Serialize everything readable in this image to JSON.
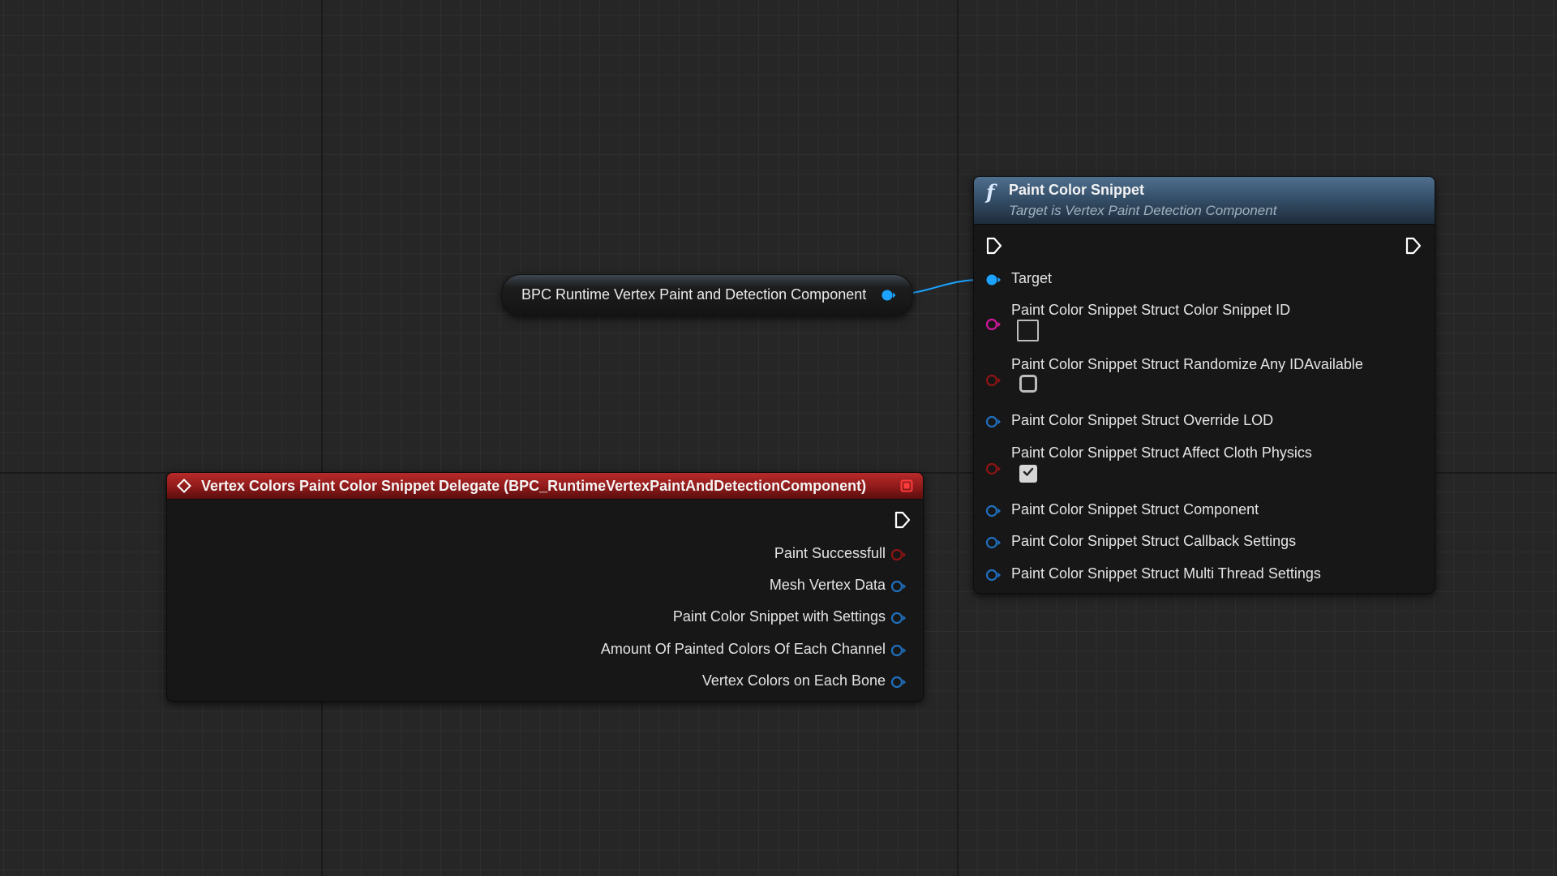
{
  "colors": {
    "background": "#262626",
    "object_pin": "#1ba3ff",
    "struct_pin": "#1f6fbf",
    "bool_pin": "#8e1414",
    "int_pin": "#d2189e",
    "function_header": "#36506a",
    "event_header": "#9a1e1e"
  },
  "variable_node": {
    "label": "BPC Runtime Vertex Paint and Detection Component",
    "pin_icon": "object-pin-icon"
  },
  "function_node": {
    "icon": "function-icon",
    "title": "Paint Color Snippet",
    "subtitle": "Target is Vertex Paint Detection Component",
    "inputs": [
      {
        "label": "Target",
        "pin": "object-pin-connected"
      },
      {
        "label": "Paint Color Snippet Struct Color Snippet ID",
        "pin": "int-pin",
        "widget": "text-box"
      },
      {
        "label": "Paint Color Snippet Struct Randomize Any IDAvailable",
        "pin": "bool-pin",
        "widget": "checkbox",
        "checked": false
      },
      {
        "label": "Paint Color Snippet Struct Override LOD",
        "pin": "struct-pin"
      },
      {
        "label": "Paint Color Snippet Struct Affect Cloth Physics",
        "pin": "bool-pin",
        "widget": "checkbox",
        "checked": true
      },
      {
        "label": "Paint Color Snippet Struct Component",
        "pin": "struct-pin"
      },
      {
        "label": "Paint Color Snippet Struct Callback Settings",
        "pin": "struct-pin"
      },
      {
        "label": "Paint Color Snippet Struct Multi Thread Settings",
        "pin": "struct-pin"
      }
    ]
  },
  "event_node": {
    "icon": "event-diamond-icon",
    "title": "Vertex Colors Paint Color Snippet Delegate (BPC_RuntimeVertexPaintAndDetectionComponent)",
    "outputs": [
      {
        "label": "Paint Successfull",
        "pin": "bool-pin"
      },
      {
        "label": "Mesh Vertex Data",
        "pin": "struct-pin"
      },
      {
        "label": "Paint Color Snippet with Settings",
        "pin": "struct-pin"
      },
      {
        "label": "Amount Of Painted Colors Of Each Channel",
        "pin": "struct-pin"
      },
      {
        "label": "Vertex Colors on Each Bone",
        "pin": "struct-pin"
      }
    ]
  }
}
